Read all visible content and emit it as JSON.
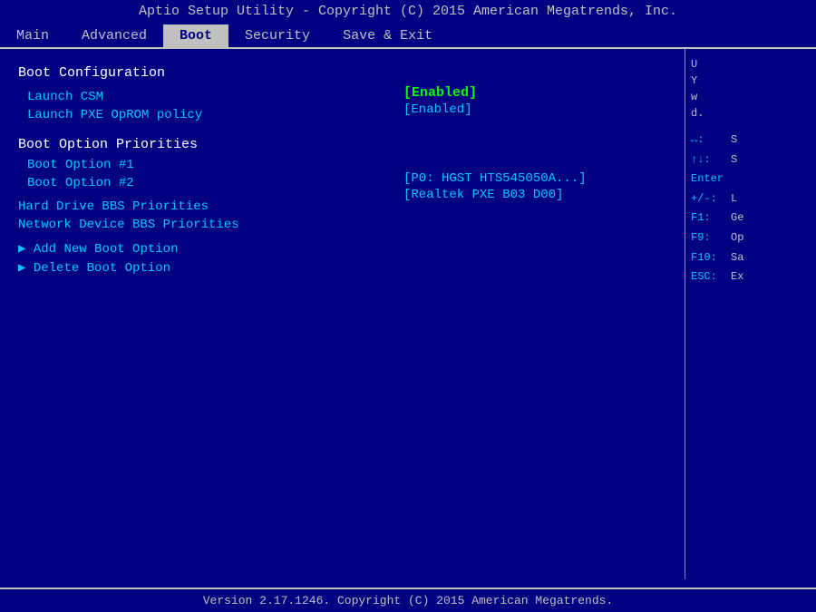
{
  "title": {
    "text": "Aptio Setup Utility - Copyright (C) 2015 American Megatrends, Inc."
  },
  "menu": {
    "items": [
      {
        "label": "Main",
        "active": false
      },
      {
        "label": "Advanced",
        "active": false
      },
      {
        "label": "Boot",
        "active": true
      },
      {
        "label": "Security",
        "active": false
      },
      {
        "label": "Save & Exit",
        "active": false
      }
    ]
  },
  "left": {
    "section1": "Boot Configuration",
    "option1": "Launch CSM",
    "option2": "Launch PXE OpROM policy",
    "section2": "Boot Option Priorities",
    "option3": "Boot Option #1",
    "option4": "Boot Option #2",
    "spacer": "",
    "option5": "Hard Drive BBS Priorities",
    "option6": "Network Device BBS Priorities",
    "spacer2": "",
    "option7": "Add New Boot Option",
    "option8": "Delete Boot Option"
  },
  "values": {
    "launch_csm": "[Enabled]",
    "launch_pxe": "[Enabled]",
    "boot1": "[P0: HGST HTS545050A...]",
    "boot2": "[Realtek PXE B03 D00]"
  },
  "right": {
    "info": [
      "U",
      "Y",
      "w",
      "d."
    ],
    "keys": [
      {
        "key": "↔:",
        "desc": "S"
      },
      {
        "key": "↑↓:",
        "desc": "S"
      },
      {
        "key": "Enter",
        "desc": ""
      },
      {
        "key": "+/-:",
        "desc": "L"
      },
      {
        "key": "F1:",
        "desc": "Ge"
      },
      {
        "key": "F9:",
        "desc": "Op"
      },
      {
        "key": "F10:",
        "desc": "Sa"
      },
      {
        "key": "ESC:",
        "desc": "Ex"
      }
    ]
  },
  "bottom": {
    "text": "Version 2.17.1246. Copyright (C) 2015 American Megatrends."
  }
}
